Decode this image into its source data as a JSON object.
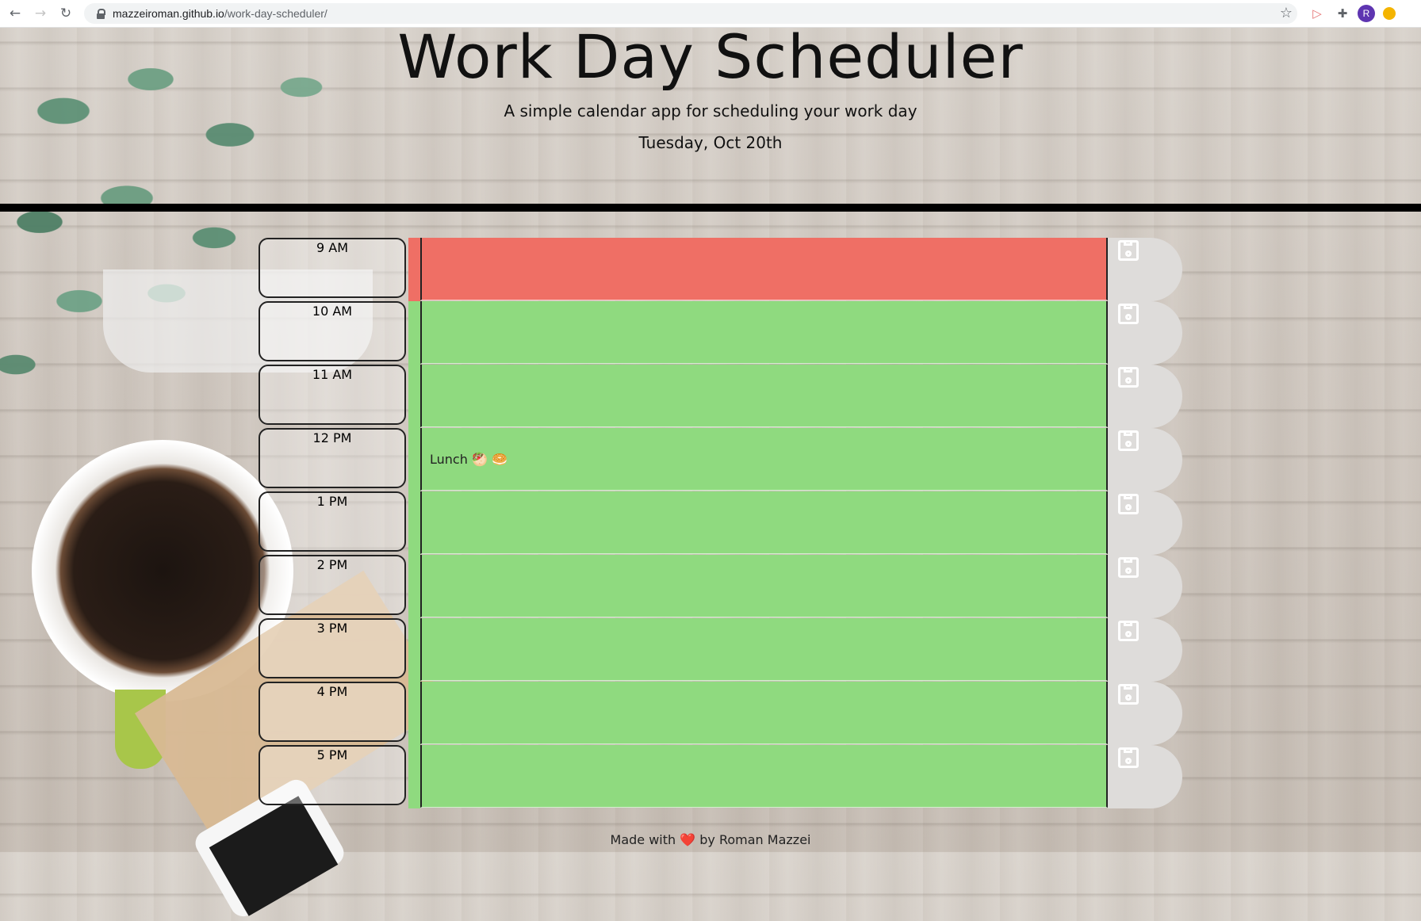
{
  "browser": {
    "url_host": "mazzeiroman.github.io",
    "url_path": "/work-day-scheduler/",
    "avatar_letter": "R"
  },
  "header": {
    "title": "Work Day Scheduler",
    "subtitle": "A simple calendar app for scheduling your work day",
    "date": "Tuesday, Oct 20th"
  },
  "colors": {
    "past": "#ef6f65",
    "future": "#8fda7f",
    "save_bg": "#dedcda"
  },
  "schedule": [
    {
      "hour": "9 AM",
      "text": "",
      "status": "past"
    },
    {
      "hour": "10 AM",
      "text": "",
      "status": "future"
    },
    {
      "hour": "11 AM",
      "text": "",
      "status": "future"
    },
    {
      "hour": "12 PM",
      "text": "Lunch 🥙 🥯",
      "status": "future"
    },
    {
      "hour": "1 PM",
      "text": "",
      "status": "future"
    },
    {
      "hour": "2 PM",
      "text": "",
      "status": "future"
    },
    {
      "hour": "3 PM",
      "text": "",
      "status": "future"
    },
    {
      "hour": "4 PM",
      "text": "",
      "status": "future"
    },
    {
      "hour": "5 PM",
      "text": "",
      "status": "future"
    }
  ],
  "footer": {
    "prefix": "Made with",
    "heart": "❤️",
    "suffix": "by Roman Mazzei"
  }
}
